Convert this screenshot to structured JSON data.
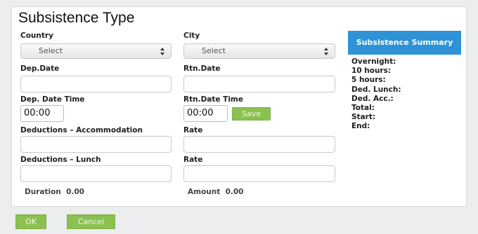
{
  "dialog": {
    "title": "Subsistence Type"
  },
  "form": {
    "country_label": "Country",
    "country_value": "Select",
    "city_label": "City",
    "city_value": "Select",
    "dep_date_label": "Dep.Date",
    "dep_date_value": "",
    "rtn_date_label": "Rtn.Date",
    "rtn_date_value": "",
    "dep_time_label": "Dep. Date Time",
    "dep_time_value": "00:00",
    "rtn_time_label": "Rtn.Date Time",
    "rtn_time_value": "00:00",
    "save_label": "Save",
    "ded_accommodation_label": "Deductions – Accommodation",
    "ded_accommodation_value": "",
    "rate_label_1": "Rate",
    "rate_value_1": "",
    "ded_lunch_label": "Deductions – Lunch",
    "ded_lunch_value": "",
    "rate_label_2": "Rate",
    "rate_value_2": "",
    "duration_label": "Duration",
    "duration_value": "0.00",
    "amount_label": "Amount",
    "amount_value": "0.00"
  },
  "summary": {
    "title": "Subsistence Summary",
    "items": [
      "Overnight:",
      "10 hours:",
      "5 hours:",
      "Ded. Lunch:",
      "Ded. Acc.:",
      "Total:",
      "Start:",
      "End:"
    ]
  },
  "footer": {
    "ok_label": "OK",
    "cancel_label": "Cancel"
  },
  "colors": {
    "accent_blue": "#2e92d6",
    "button_green": "#8cc152"
  }
}
